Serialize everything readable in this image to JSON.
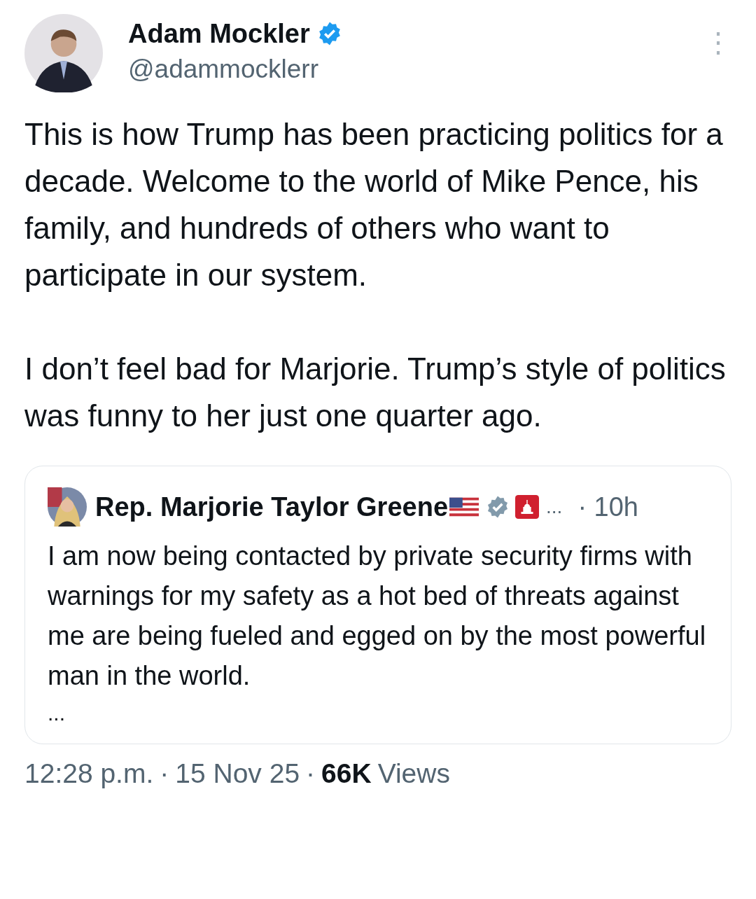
{
  "author": {
    "name": "Adam Mockler",
    "handle": "@adammocklerr",
    "verified": true
  },
  "more_icon": "⋮",
  "paragraphs": [
    "This is how Trump has been practicing politics for a decade. Welcome to the world of Mike Pence, his family, and hundreds of others who want to participate in our system.",
    "I don’t feel bad for Marjorie. Trump’s style of politics was funny to her just one quarter ago."
  ],
  "quoted_post": {
    "author": "Rep. Marjorie Taylor Greene",
    "verified": true,
    "name_ellipsis": "...",
    "time": "· 10h",
    "text": "I am now being contacted by private security firms with warnings for my safety as a hot bed of threats against me are being fueled and egged on by the most powerful man in the world.",
    "more": "..."
  },
  "footer": {
    "time": "12:28 p.m.",
    "separator_1": "·",
    "date": "15 Nov 25",
    "separator_2": "·",
    "views_count": "66K",
    "views_label": "Views"
  }
}
